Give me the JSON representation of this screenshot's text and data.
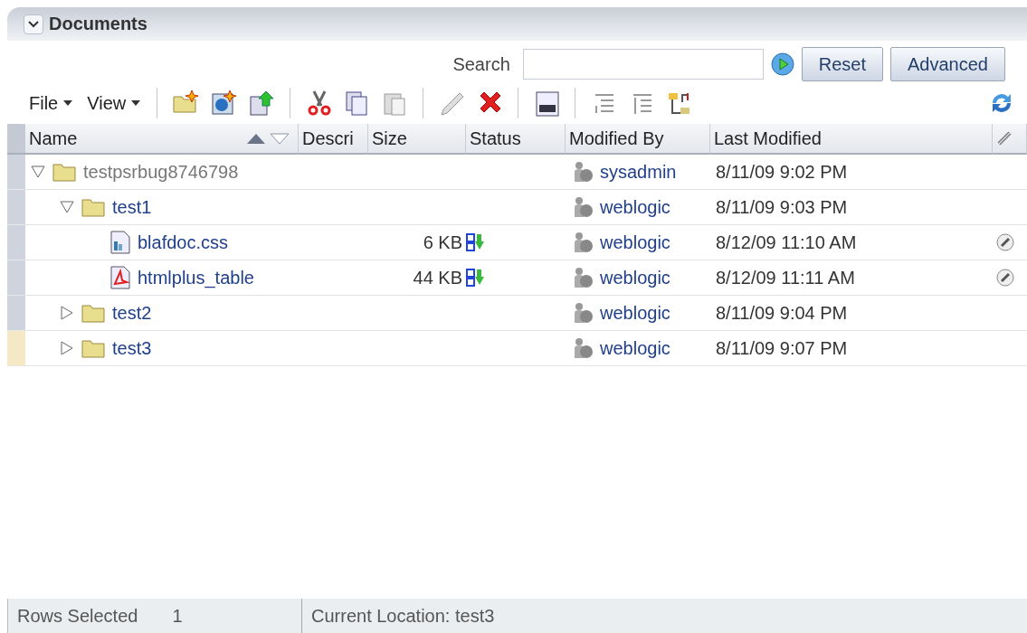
{
  "panel": {
    "title": "Documents",
    "expanded": true
  },
  "search": {
    "label": "Search",
    "buttons": [
      "Reset",
      "Advanced"
    ]
  },
  "menus": [
    "File",
    "View"
  ],
  "table": {
    "columns": [
      "Name",
      "Descri",
      "Size",
      "Status",
      "Modified By",
      "Last Modified"
    ],
    "rows": [
      {
        "kind": "folder",
        "name": "testpsrbug8746798",
        "muted": true,
        "expanded": true,
        "selected": false,
        "modified_by": "sysadmin",
        "last_modified": "8/11/09 9:02 PM",
        "linked": false,
        "children": [
          {
            "kind": "folder",
            "name": "test1",
            "muted": false,
            "expanded": true,
            "selected": false,
            "modified_by": "weblogic",
            "last_modified": "8/11/09 9:03 PM",
            "linked": false,
            "children": [
              {
                "kind": "document",
                "name": "blafdoc.css",
                "muted": false,
                "selected": false,
                "size": "6 KB",
                "modified_by": "weblogic",
                "last_modified": "8/12/09 11:10 AM",
                "linked": true
              },
              {
                "kind": "pdf",
                "name": "htmlplus_table",
                "muted": false,
                "selected": false,
                "size": "44 KB",
                "modified_by": "weblogic",
                "last_modified": "8/12/09 11:11 AM",
                "linked": true
              }
            ]
          },
          {
            "kind": "folder",
            "name": "test2",
            "muted": false,
            "expanded": false,
            "selected": false,
            "modified_by": "weblogic",
            "last_modified": "8/11/09 9:04 PM",
            "linked": false
          },
          {
            "kind": "folder",
            "name": "test3",
            "muted": false,
            "expanded": false,
            "selected": true,
            "modified_by": "weblogic",
            "last_modified": "8/11/09 9:07 PM",
            "linked": false
          }
        ]
      }
    ]
  },
  "status_bar": {
    "rows_selected_label": "Rows Selected",
    "rows_selected": "1",
    "location": "Current Location: test3"
  }
}
